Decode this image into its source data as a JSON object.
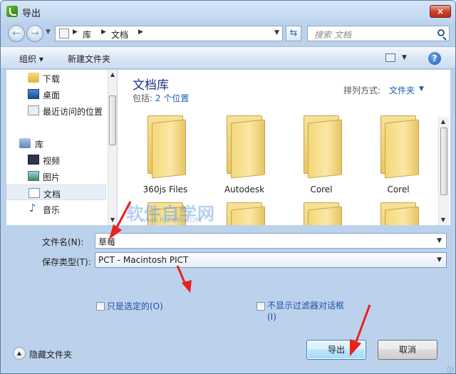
{
  "window": {
    "title": "导出",
    "close_label": "×"
  },
  "address": {
    "crumbs": [
      "库",
      "文档"
    ],
    "search_placeholder": "搜索 文档"
  },
  "toolbar": {
    "organize_label": "组织 ▾",
    "new_folder_label": "新建文件夹"
  },
  "sidebar": {
    "items": [
      {
        "label": "下载",
        "icon": "download-folder-icon"
      },
      {
        "label": "桌面",
        "icon": "desktop-icon"
      },
      {
        "label": "最近访问的位置",
        "icon": "recent-places-icon"
      },
      {
        "label": "库",
        "icon": "libraries-icon"
      },
      {
        "label": "视频",
        "icon": "video-library-icon"
      },
      {
        "label": "图片",
        "icon": "picture-library-icon"
      },
      {
        "label": "文档",
        "icon": "document-library-icon",
        "selected": true
      },
      {
        "label": "音乐",
        "icon": "music-library-icon"
      }
    ]
  },
  "content": {
    "library_title": "文档库",
    "includes_label": "包括:",
    "includes_locations": "2 个位置",
    "arrange_label": "排列方式:",
    "arrange_value": "文件夹",
    "files": [
      {
        "label": "360js Files"
      },
      {
        "label": "Autodesk"
      },
      {
        "label": "Corel"
      },
      {
        "label": "Corel"
      }
    ],
    "watermark": "软件自学网",
    "watermark_sub": "www.RJZXW.COM"
  },
  "form": {
    "filename_label": "文件名(N):",
    "filename_value": "草莓",
    "filetype_label": "保存类型(T):",
    "filetype_value": "PCT - Macintosh PICT",
    "selected_only_label": "只是选定的(O)",
    "no_filter_dialog_label": "不显示过滤器对话框 (I)",
    "hide_folders_label": "隐藏文件夹",
    "export_label": "导出",
    "cancel_label": "取消"
  },
  "colors": {
    "accent_link": "#1a5fb4",
    "annotation_arrow": "#e8221c"
  }
}
